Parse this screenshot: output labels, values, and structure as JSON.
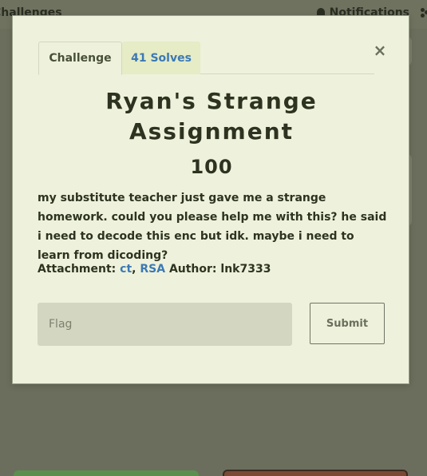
{
  "navbar": {
    "left_text": "Challenges",
    "notifications_label": "Notifications"
  },
  "modal": {
    "tabs": [
      {
        "label": "Challenge"
      },
      {
        "label": "41 Solves"
      }
    ],
    "close_label": "×",
    "title": "Ryan's Strange Assignment",
    "points": "100",
    "description": "my substitute teacher just gave me a strange homework. could you please help me with this? he said i need to decode this enc but idk. maybe i need to learn from dicoding?",
    "attachment_label": "Attachment:",
    "attachments": [
      "ct",
      "RSA"
    ],
    "attachment_separator": ",",
    "author_label": "Author:",
    "author": "lnk7333",
    "flag_placeholder": "Flag",
    "submit_label": "Submit"
  },
  "colors": {
    "overlay": "#6b6e5c",
    "modal_bg": "#eef2dc",
    "accent": "#3b79b4",
    "input_bg": "#d3d6c1",
    "card_green": "#5a8f4e",
    "card_brown": "#7a4a35"
  }
}
